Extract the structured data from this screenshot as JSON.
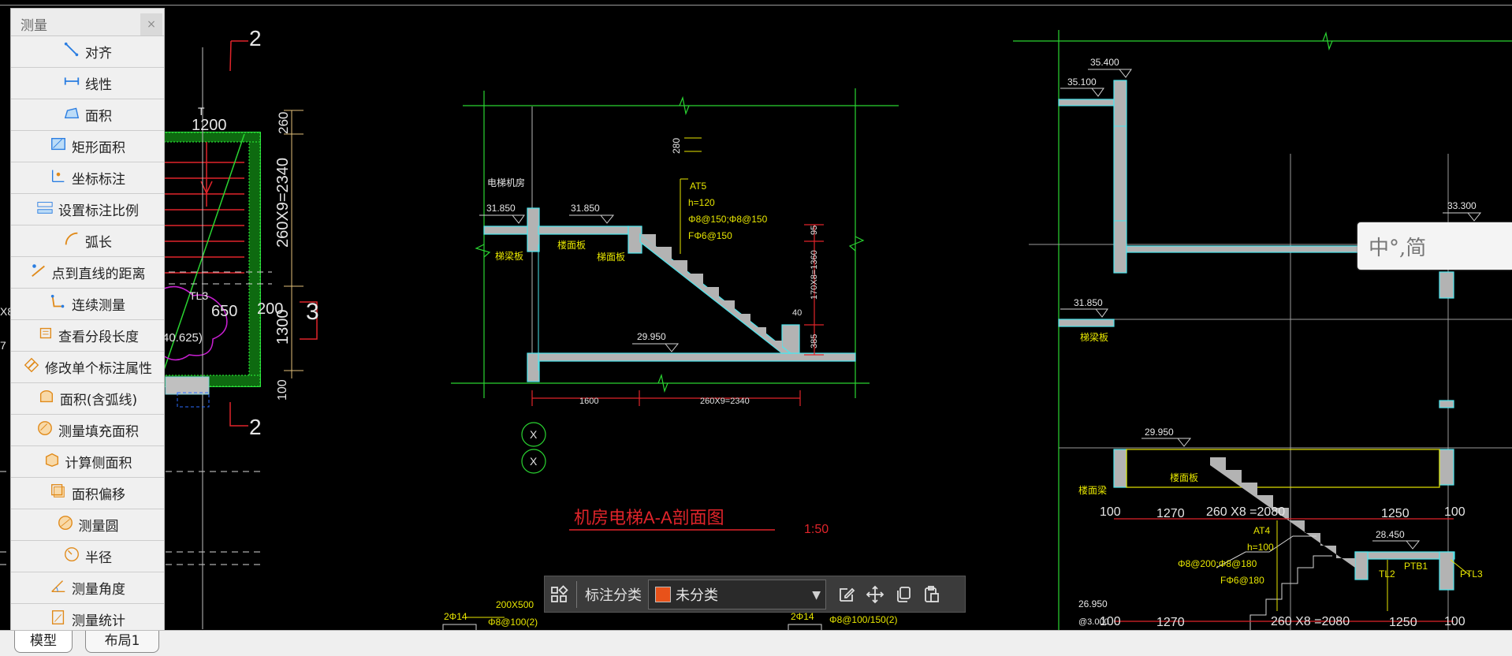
{
  "panel": {
    "title": "测量",
    "close": "×",
    "tools": [
      {
        "label": "对齐",
        "icon": "aligned-dimension-icon"
      },
      {
        "label": "线性",
        "icon": "linear-dimension-icon"
      },
      {
        "label": "面积",
        "icon": "area-icon"
      },
      {
        "label": "矩形面积",
        "icon": "rect-area-icon"
      },
      {
        "label": "坐标标注",
        "icon": "coordinate-icon"
      },
      {
        "label": "设置标注比例",
        "icon": "scale-icon"
      },
      {
        "label": "弧长",
        "icon": "arc-length-icon"
      },
      {
        "label": "点到直线的距离",
        "icon": "point-line-distance-icon"
      },
      {
        "label": "连续测量",
        "icon": "continuous-measure-icon"
      },
      {
        "label": "查看分段长度",
        "icon": "segment-length-icon"
      },
      {
        "label": "修改单个标注属性",
        "icon": "edit-dimension-icon"
      },
      {
        "label": "面积(含弧线)",
        "icon": "arc-area-icon"
      },
      {
        "label": "测量填充面积",
        "icon": "hatch-area-icon"
      },
      {
        "label": "计算侧面积",
        "icon": "side-area-icon"
      },
      {
        "label": "面积偏移",
        "icon": "area-offset-icon"
      },
      {
        "label": "测量圆",
        "icon": "circle-icon"
      },
      {
        "label": "半径",
        "icon": "radius-icon"
      },
      {
        "label": "测量角度",
        "icon": "angle-icon"
      },
      {
        "label": "测量统计",
        "icon": "statistics-icon"
      }
    ]
  },
  "tabs": {
    "model": "模型",
    "layout": "布局1"
  },
  "anno_bar": {
    "label": "标注分类",
    "selected": "未分类",
    "swatch": "#e8521a"
  },
  "ime": {
    "text": "中°,简"
  },
  "drawing": {
    "left": {
      "t1": "2",
      "t2": "1200",
      "t3": "260X9=2340",
      "t4": "260",
      "t5": "1300",
      "t6": "100",
      "t7": "TL3",
      "t8": "650",
      "t9": "200",
      "t10": "3",
      "t11": "2",
      "t12": "40.625)",
      "t13": "T",
      "t14": "X8",
      "t15": "7"
    },
    "mid": {
      "t1": "280",
      "t2": "电梯机房",
      "t3": "31.850",
      "t4": "31.850",
      "t5": "楼面板",
      "t6": "梯梁板",
      "t7": "梯面板",
      "t8": "AT5",
      "t9": "h=120",
      "t10": "Φ8@150;Φ8@150",
      "t11": "FΦ6@150",
      "t12": "95",
      "t13": "170X8=1360",
      "t14": "40",
      "t15": "385",
      "t16": "29.950",
      "t17": "1600",
      "t18": "260X9=2340",
      "t19": "机房电梯A-A剖面图",
      "t20": "1:50",
      "t21": "X",
      "t22": "X"
    },
    "right": {
      "t1": "35.400",
      "t2": "35.100",
      "t3": "33.300",
      "t4": "31.850",
      "t5": "梯梁板",
      "t6": "29.950",
      "t7": "楼面梁",
      "t8": "楼面板",
      "t9": "100",
      "t10": "1270",
      "t11": "260 X8 =2080",
      "t12": "1250",
      "t13": "100",
      "t14": "AT4",
      "t15": "h=100",
      "t16": "Φ8@200;Φ8@180",
      "t17": "FΦ6@180",
      "t18": "28.450",
      "t19": "PTB1",
      "t20": "TL2",
      "t21": "PTL3",
      "t22": "26.950",
      "t23": "100",
      "t24": "@3.000",
      "t25": "1270",
      "t26": "260 X8 =2080",
      "t27": "1250",
      "t28": "100"
    },
    "bottom": {
      "t1": "200X500",
      "t2": "2Φ14",
      "t3": "Φ8@100(2)",
      "t4": "2Φ14",
      "t5": "Φ8@100/150(2)"
    }
  }
}
